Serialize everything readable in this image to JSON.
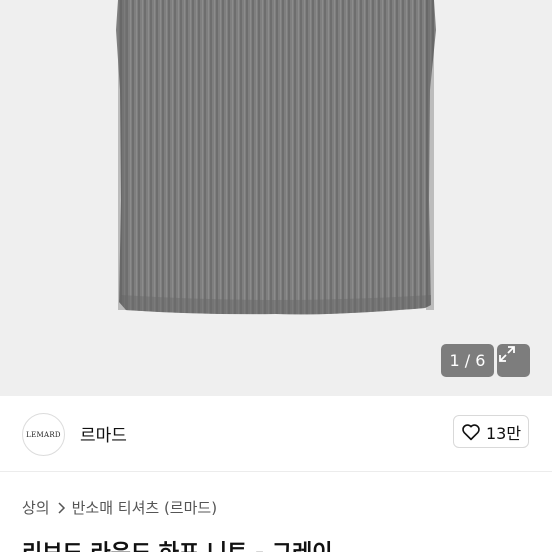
{
  "gallery": {
    "counter": "1 / 6"
  },
  "seller": {
    "avatar_text": "LEMARD",
    "name": "르마드",
    "likes": "13만"
  },
  "breadcrumb": {
    "category": "상의",
    "subcategory": "반소매 티셔츠 (르마드)"
  },
  "product": {
    "title": "리브드 라운드 하프 니트 - 그레이"
  },
  "colors": {
    "fabric": "#7d7d7d",
    "background": "#eeeeee",
    "text_primary": "#111111",
    "text_secondary": "#555555"
  }
}
